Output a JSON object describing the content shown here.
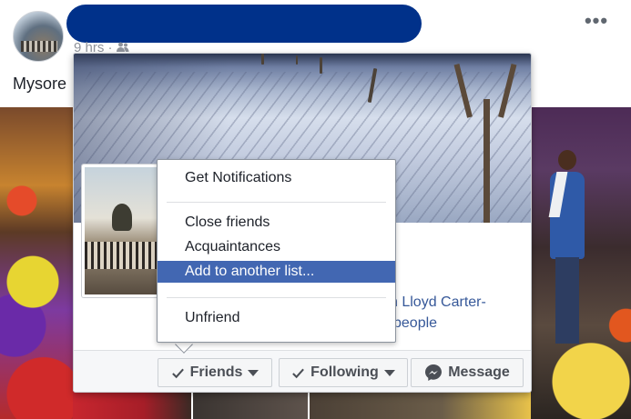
{
  "post": {
    "time": "9 hrs ·",
    "text": "Mysore",
    "privacy_icon": "friends-icon"
  },
  "hovercard": {
    "mutual_line1": "h Lloyd Carter-",
    "mutual_line2": "people"
  },
  "dropdown": {
    "items": [
      {
        "label": "Get Notifications"
      },
      {
        "label": "Close friends"
      },
      {
        "label": "Acquaintances"
      },
      {
        "label": "Add to another list...",
        "highlighted": true
      },
      {
        "label": "Unfriend"
      }
    ]
  },
  "actions": {
    "friends_label": "Friends",
    "following_label": "Following",
    "message_label": "Message"
  },
  "colors": {
    "link": "#365899",
    "menu_highlight": "#4267b2",
    "redaction": "#00318a"
  }
}
